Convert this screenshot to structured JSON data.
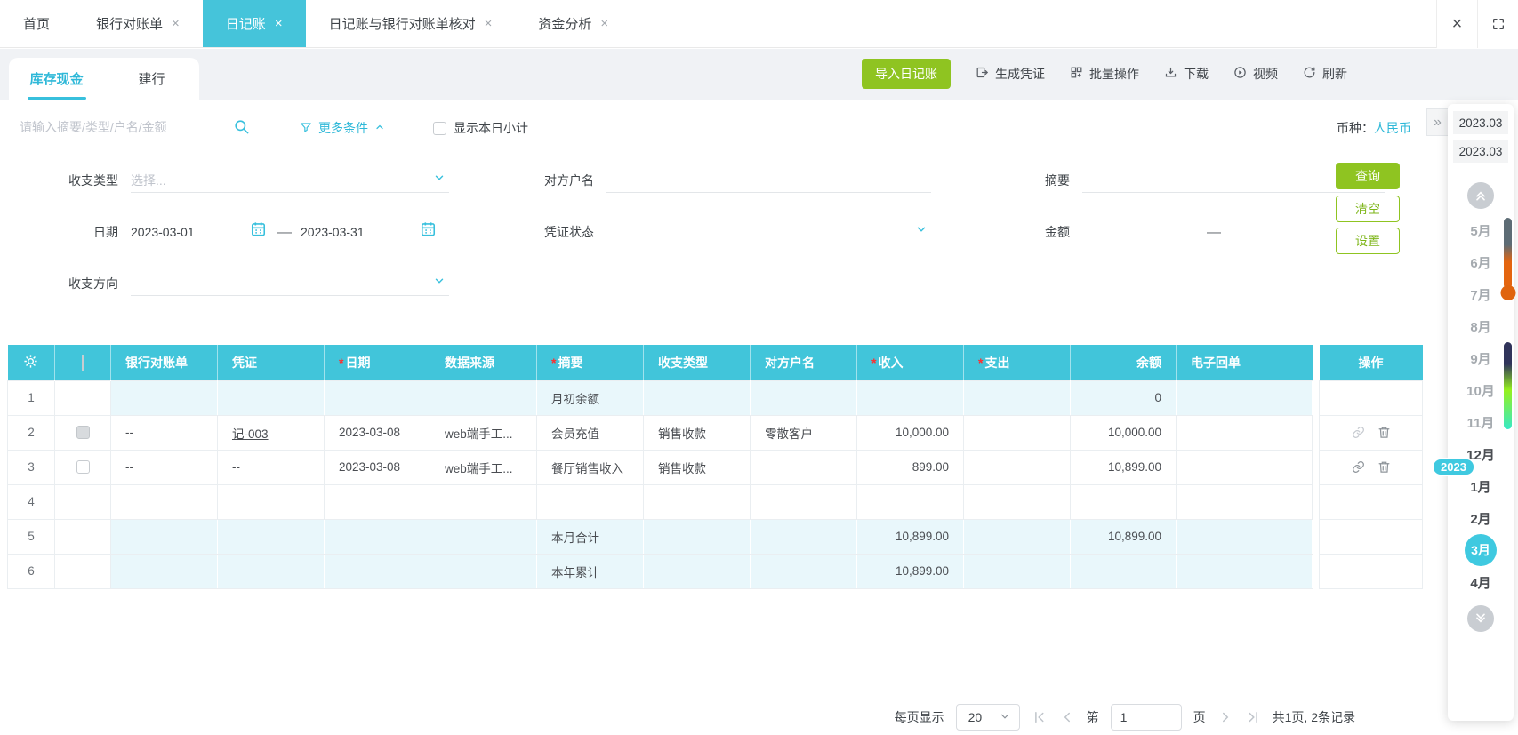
{
  "colors": {
    "primary_cyan": "#41c5da",
    "accent_green": "#8fc421",
    "link_cyan": "#2eb8d8",
    "highlight_row": "#e9f7fb",
    "required_red": "#ff2d2d"
  },
  "window": {
    "close_label": "×"
  },
  "top_tabs": [
    {
      "label": "首页",
      "closable": false,
      "active": false
    },
    {
      "label": "银行对账单",
      "closable": true,
      "active": false
    },
    {
      "label": "日记账",
      "closable": true,
      "active": true
    },
    {
      "label": "日记账与银行对账单核对",
      "closable": true,
      "active": false
    },
    {
      "label": "资金分析",
      "closable": true,
      "active": false
    }
  ],
  "account_tabs": [
    {
      "label": "库存现金",
      "active": true
    },
    {
      "label": "建行",
      "active": false
    }
  ],
  "toolbar": {
    "import_label": "导入日记账",
    "generate_label": "生成凭证",
    "batch_label": "批量操作",
    "download_label": "下载",
    "video_label": "视频",
    "refresh_label": "刷新"
  },
  "search": {
    "placeholder": "请输入摘要/类型/户名/金额",
    "more_label": "更多条件",
    "subtotal_label": "显示本日小计",
    "currency_label": "币种：",
    "currency_value": "人民币"
  },
  "filters": {
    "type_label": "收支类型",
    "type_placeholder": "选择...",
    "counterparty_label": "对方户名",
    "summary_label": "摘要",
    "date_label": "日期",
    "date_from": "2023-03-01",
    "date_to": "2023-03-31",
    "range_separator": "—",
    "voucher_status_label": "凭证状态",
    "amount_label": "金额",
    "direction_label": "收支方向",
    "query_label": "查询",
    "clear_label": "清空",
    "settings_label": "设置"
  },
  "table": {
    "ops_header": "操作",
    "headers": [
      {
        "label": "银行对账单"
      },
      {
        "label": "凭证"
      },
      {
        "label": "日期",
        "required": true
      },
      {
        "label": "数据来源"
      },
      {
        "label": "摘要",
        "required": true
      },
      {
        "label": "收支类型"
      },
      {
        "label": "对方户名"
      },
      {
        "label": "收入",
        "required": true
      },
      {
        "label": "支出",
        "required": true
      },
      {
        "label": "余额"
      },
      {
        "label": "电子回单"
      }
    ],
    "rows": [
      {
        "num": "1",
        "highlight": true,
        "cells": {
          "summary": "月初余额",
          "balance": "0"
        }
      },
      {
        "num": "2",
        "checkbox": "filled",
        "ops": true,
        "link_muted": true,
        "cells": {
          "bank": "--",
          "voucher": "记-003",
          "voucher_link": true,
          "date": "2023-03-08",
          "source": "web端手工...",
          "summary": "会员充值",
          "type": "销售收款",
          "counterparty": "零散客户",
          "income": "10,000.00",
          "balance": "10,000.00"
        }
      },
      {
        "num": "3",
        "checkbox": "unchecked",
        "ops": true,
        "cells": {
          "bank": "--",
          "voucher": "--",
          "date": "2023-03-08",
          "source": "web端手工...",
          "summary": "餐厅销售收入",
          "type": "销售收款",
          "income": "899.00",
          "balance": "10,899.00"
        }
      },
      {
        "num": "4",
        "cells": {}
      },
      {
        "num": "5",
        "highlight": true,
        "cells": {
          "summary": "本月合计",
          "income": "10,899.00",
          "balance": "10,899.00"
        }
      },
      {
        "num": "6",
        "highlight": true,
        "cells": {
          "summary": "本年累计",
          "income": "10,899.00"
        }
      }
    ]
  },
  "pagination": {
    "per_page_label": "每页显示",
    "per_page_value": "20",
    "page_label_prefix": "第",
    "page_value": "1",
    "page_label_suffix": "页",
    "total_label": "共1页, 2条记录"
  },
  "month_panel": {
    "period_top": "2023.03",
    "period_current": "2023.03",
    "year_badge": "2023",
    "months": [
      {
        "label": "5月",
        "muted": true
      },
      {
        "label": "6月",
        "muted": true
      },
      {
        "label": "7月",
        "muted": true
      },
      {
        "label": "8月",
        "muted": true
      },
      {
        "label": "9月",
        "muted": true
      },
      {
        "label": "10月",
        "muted": true
      },
      {
        "label": "11月",
        "muted": true
      },
      {
        "label": "12月"
      },
      {
        "label": "1月"
      },
      {
        "label": "2月"
      },
      {
        "label": "3月",
        "active": true
      },
      {
        "label": "4月"
      }
    ]
  }
}
